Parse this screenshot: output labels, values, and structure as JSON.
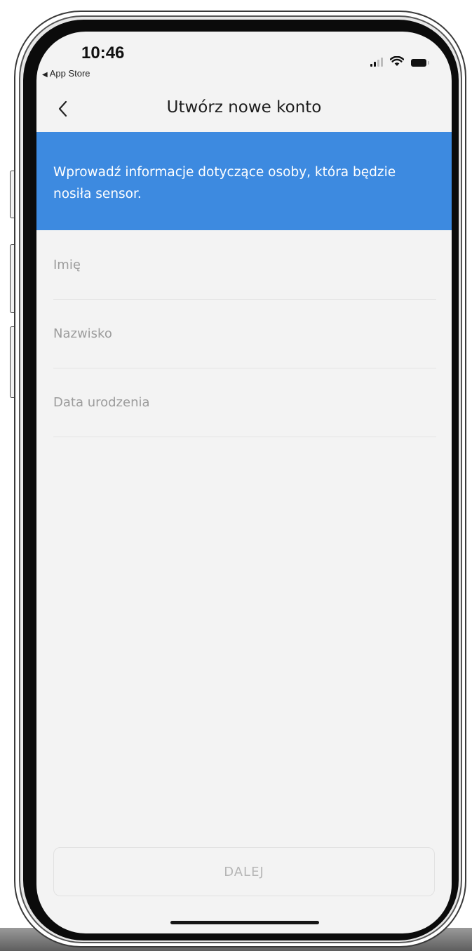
{
  "status_bar": {
    "time": "10:46",
    "back_app": "App Store",
    "back_arrow_icon": "back-triangle-icon",
    "icons": [
      "cellular-signal-icon",
      "wifi-icon",
      "battery-icon"
    ]
  },
  "header": {
    "title": "Utwórz nowe konto",
    "back_icon": "chevron-left-icon"
  },
  "banner": {
    "text": "Wprowadź informacje dotyczące osoby, która będzie nosiła sensor.",
    "color": "#3d8ae0"
  },
  "form": {
    "fields": [
      {
        "placeholder": "Imię"
      },
      {
        "placeholder": "Nazwisko"
      },
      {
        "placeholder": "Data urodzenia"
      }
    ]
  },
  "footer": {
    "next_label": "DALEJ",
    "next_enabled": false
  },
  "colors": {
    "screen_background": "#f3f3f3",
    "placeholder_text": "#9c9c9c",
    "disabled_text": "#b6b6b6"
  }
}
